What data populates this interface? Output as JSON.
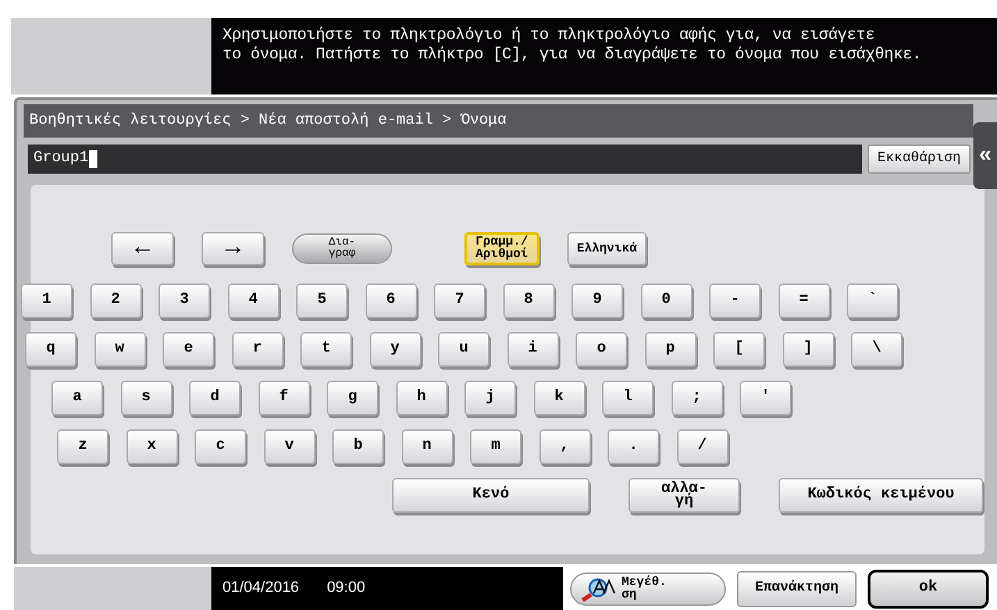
{
  "message": "Χρησιμοποιήστε το πληκτρολόγιο ή το πληκτρολόγιο αφής για, να εισάγετε\nτο όνομα. Πατήστε το πλήκτρο [C], για να διαγράψετε το όνομα που εισάχθηκε.",
  "breadcrumb": "Βοηθητικές λειτουργίες > Νέα αποστολή e-mail > Όνομα",
  "name_field": {
    "value": "Group1"
  },
  "clear_button": "Εκκαθάριση",
  "side_tab": "«",
  "function_keys": [
    {
      "kind": "arrow",
      "label": "←"
    },
    {
      "kind": "arrow",
      "label": "→"
    },
    {
      "kind": "pill",
      "label": "Δια-\nγραφ"
    },
    {
      "kind": "mode",
      "label": "Γραμμ./\nΑριθμοί",
      "selected": true
    },
    {
      "kind": "mode",
      "label": "Ελληνικά",
      "selected": false
    }
  ],
  "key_rows": [
    [
      "1",
      "2",
      "3",
      "4",
      "5",
      "6",
      "7",
      "8",
      "9",
      "0",
      "-",
      "=",
      "`"
    ],
    [
      "q",
      "w",
      "e",
      "r",
      "t",
      "y",
      "u",
      "i",
      "o",
      "p",
      "[",
      "]",
      "\\"
    ],
    [
      "a",
      "s",
      "d",
      "f",
      "g",
      "h",
      "j",
      "k",
      "l",
      ";",
      "'"
    ],
    [
      "z",
      "x",
      "c",
      "v",
      "b",
      "n",
      "m",
      ",",
      ".",
      "/"
    ]
  ],
  "bottom_keys": [
    "Κενό",
    "αλλα-\nγή",
    "Κωδικός κειμένου"
  ],
  "status": {
    "date": "01/04/2016",
    "time": "09:00"
  },
  "footer_buttons": [
    {
      "kind": "zoom",
      "label": "Μεγέθ.\nση"
    },
    {
      "kind": "plain",
      "label": "Επανάκτηση"
    },
    {
      "kind": "ok",
      "label": "ok"
    }
  ]
}
